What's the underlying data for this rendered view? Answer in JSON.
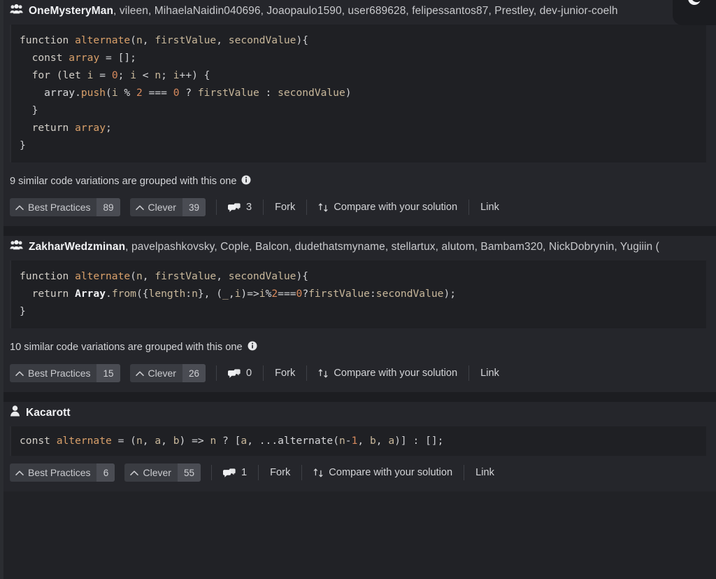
{
  "theme": {
    "page_bg": "#212226",
    "card_bg": "#25262b",
    "code_bg": "#1f2024",
    "divider": "#1c1d21",
    "button_bg": "#3a3c42",
    "count_bg": "#4a4c53",
    "text": "#d3d4d7",
    "text_bright": "#f2f3f5"
  },
  "dark_mode_toggle": {
    "icon": "moon-icon",
    "label": "Toggle dark mode"
  },
  "solutions": [
    {
      "author_icon": "group-icon",
      "primary_author": "OneMysteryMan",
      "other_authors": ", vileen, MihaelaNaidin040696, Joaopaulo1590, user689628, felipessantos87, Prestley, dev-junior-coelh",
      "code_lines": [
        [
          {
            "t": "function ",
            "c": "t-kw"
          },
          {
            "t": "alternate",
            "c": "t-fn"
          },
          {
            "t": "(",
            "c": "t-punc"
          },
          {
            "t": "n",
            "c": "t-par"
          },
          {
            "t": ", ",
            "c": "t-punc"
          },
          {
            "t": "firstValue",
            "c": "t-par"
          },
          {
            "t": ", ",
            "c": "t-punc"
          },
          {
            "t": "secondValue",
            "c": "t-par"
          },
          {
            "t": "){",
            "c": "t-punc"
          }
        ],
        [
          {
            "t": "  const ",
            "c": "t-kw"
          },
          {
            "t": "array",
            "c": "t-fn"
          },
          {
            "t": " = [];",
            "c": "t-punc"
          }
        ],
        [
          {
            "t": "  for (",
            "c": "t-kw"
          },
          {
            "t": "let ",
            "c": "t-kw"
          },
          {
            "t": "i",
            "c": "t-par"
          },
          {
            "t": " = ",
            "c": "t-op"
          },
          {
            "t": "0",
            "c": "t-num"
          },
          {
            "t": "; ",
            "c": "t-punc"
          },
          {
            "t": "i",
            "c": "t-par"
          },
          {
            "t": " < ",
            "c": "t-op"
          },
          {
            "t": "n",
            "c": "t-par"
          },
          {
            "t": "; ",
            "c": "t-punc"
          },
          {
            "t": "i",
            "c": "t-par"
          },
          {
            "t": "++) {",
            "c": "t-punc"
          }
        ],
        [
          {
            "t": "    array",
            "c": "t-plain"
          },
          {
            "t": ".",
            "c": "t-punc"
          },
          {
            "t": "push",
            "c": "t-fn"
          },
          {
            "t": "(",
            "c": "t-punc"
          },
          {
            "t": "i",
            "c": "t-par"
          },
          {
            "t": " % ",
            "c": "t-op"
          },
          {
            "t": "2",
            "c": "t-num"
          },
          {
            "t": " === ",
            "c": "t-op"
          },
          {
            "t": "0",
            "c": "t-num"
          },
          {
            "t": " ? ",
            "c": "t-op"
          },
          {
            "t": "firstValue",
            "c": "t-par"
          },
          {
            "t": " : ",
            "c": "t-op"
          },
          {
            "t": "secondValue",
            "c": "t-par"
          },
          {
            "t": ")",
            "c": "t-punc"
          }
        ],
        [
          {
            "t": "  }",
            "c": "t-punc"
          }
        ],
        [
          {
            "t": "  return ",
            "c": "t-kw"
          },
          {
            "t": "array",
            "c": "t-fn"
          },
          {
            "t": ";",
            "c": "t-punc"
          }
        ],
        [
          {
            "t": "}",
            "c": "t-punc"
          }
        ]
      ],
      "grouped_text": "9 similar code variations are grouped with this one",
      "info_icon": "info-icon",
      "best_practices_label": "Best Practices",
      "best_practices_count": "89",
      "clever_label": "Clever",
      "clever_count": "39",
      "comments_count": "3",
      "fork_label": "Fork",
      "compare_label": "Compare with your solution",
      "link_label": "Link"
    },
    {
      "author_icon": "group-icon",
      "primary_author": "ZakharWedzminan",
      "other_authors": ", pavelpashkovsky, Cople, Balcon, dudethatsmyname, stellartux, alutom, Bambam320, NickDobrynin, Yugiiin (",
      "code_lines": [
        [
          {
            "t": "function ",
            "c": "t-kw"
          },
          {
            "t": "alternate",
            "c": "t-fn"
          },
          {
            "t": "(",
            "c": "t-punc"
          },
          {
            "t": "n",
            "c": "t-par"
          },
          {
            "t": ", ",
            "c": "t-punc"
          },
          {
            "t": "firstValue",
            "c": "t-par"
          },
          {
            "t": ", ",
            "c": "t-punc"
          },
          {
            "t": "secondValue",
            "c": "t-par"
          },
          {
            "t": "){",
            "c": "t-punc"
          }
        ],
        [
          {
            "t": "  return ",
            "c": "t-kw"
          },
          {
            "t": "Array",
            "c": "t-cls"
          },
          {
            "t": ".",
            "c": "t-punc"
          },
          {
            "t": "from",
            "c": "t-prop"
          },
          {
            "t": "({",
            "c": "t-punc"
          },
          {
            "t": "length",
            "c": "t-par"
          },
          {
            "t": ":",
            "c": "t-punc"
          },
          {
            "t": "n",
            "c": "t-par"
          },
          {
            "t": "}, (",
            "c": "t-punc"
          },
          {
            "t": "_",
            "c": "t-par"
          },
          {
            "t": ",",
            "c": "t-punc"
          },
          {
            "t": "i",
            "c": "t-par"
          },
          {
            "t": ")=>",
            "c": "t-op"
          },
          {
            "t": "i",
            "c": "t-par"
          },
          {
            "t": "%",
            "c": "t-op"
          },
          {
            "t": "2",
            "c": "t-num"
          },
          {
            "t": "===",
            "c": "t-op"
          },
          {
            "t": "0",
            "c": "t-num"
          },
          {
            "t": "?",
            "c": "t-op"
          },
          {
            "t": "firstValue",
            "c": "t-par"
          },
          {
            "t": ":",
            "c": "t-op"
          },
          {
            "t": "secondValue",
            "c": "t-par"
          },
          {
            "t": ");",
            "c": "t-punc"
          }
        ],
        [
          {
            "t": "}",
            "c": "t-punc"
          }
        ]
      ],
      "grouped_text": "10 similar code variations are grouped with this one",
      "info_icon": "info-icon",
      "best_practices_label": "Best Practices",
      "best_practices_count": "15",
      "clever_label": "Clever",
      "clever_count": "26",
      "comments_count": "0",
      "fork_label": "Fork",
      "compare_label": "Compare with your solution",
      "link_label": "Link"
    },
    {
      "author_icon": "user-icon",
      "primary_author": "Kacarott",
      "other_authors": "",
      "code_lines": [
        [
          {
            "t": "const ",
            "c": "t-kw"
          },
          {
            "t": "alternate",
            "c": "t-fn"
          },
          {
            "t": " = (",
            "c": "t-punc"
          },
          {
            "t": "n",
            "c": "t-par"
          },
          {
            "t": ", ",
            "c": "t-punc"
          },
          {
            "t": "a",
            "c": "t-par"
          },
          {
            "t": ", ",
            "c": "t-punc"
          },
          {
            "t": "b",
            "c": "t-par"
          },
          {
            "t": ") => ",
            "c": "t-op"
          },
          {
            "t": "n",
            "c": "t-par"
          },
          {
            "t": " ? [",
            "c": "t-punc"
          },
          {
            "t": "a",
            "c": "t-par"
          },
          {
            "t": ", ...",
            "c": "t-punc"
          },
          {
            "t": "alternate",
            "c": "t-plain"
          },
          {
            "t": "(",
            "c": "t-punc"
          },
          {
            "t": "n",
            "c": "t-par"
          },
          {
            "t": "-",
            "c": "t-op"
          },
          {
            "t": "1",
            "c": "t-num"
          },
          {
            "t": ", ",
            "c": "t-punc"
          },
          {
            "t": "b",
            "c": "t-par"
          },
          {
            "t": ", ",
            "c": "t-punc"
          },
          {
            "t": "a",
            "c": "t-par"
          },
          {
            "t": ")] : [];",
            "c": "t-punc"
          }
        ]
      ],
      "grouped_text": "",
      "info_icon": "",
      "best_practices_label": "Best Practices",
      "best_practices_count": "6",
      "clever_label": "Clever",
      "clever_count": "55",
      "comments_count": "1",
      "fork_label": "Fork",
      "compare_label": "Compare with your solution",
      "link_label": "Link"
    }
  ]
}
